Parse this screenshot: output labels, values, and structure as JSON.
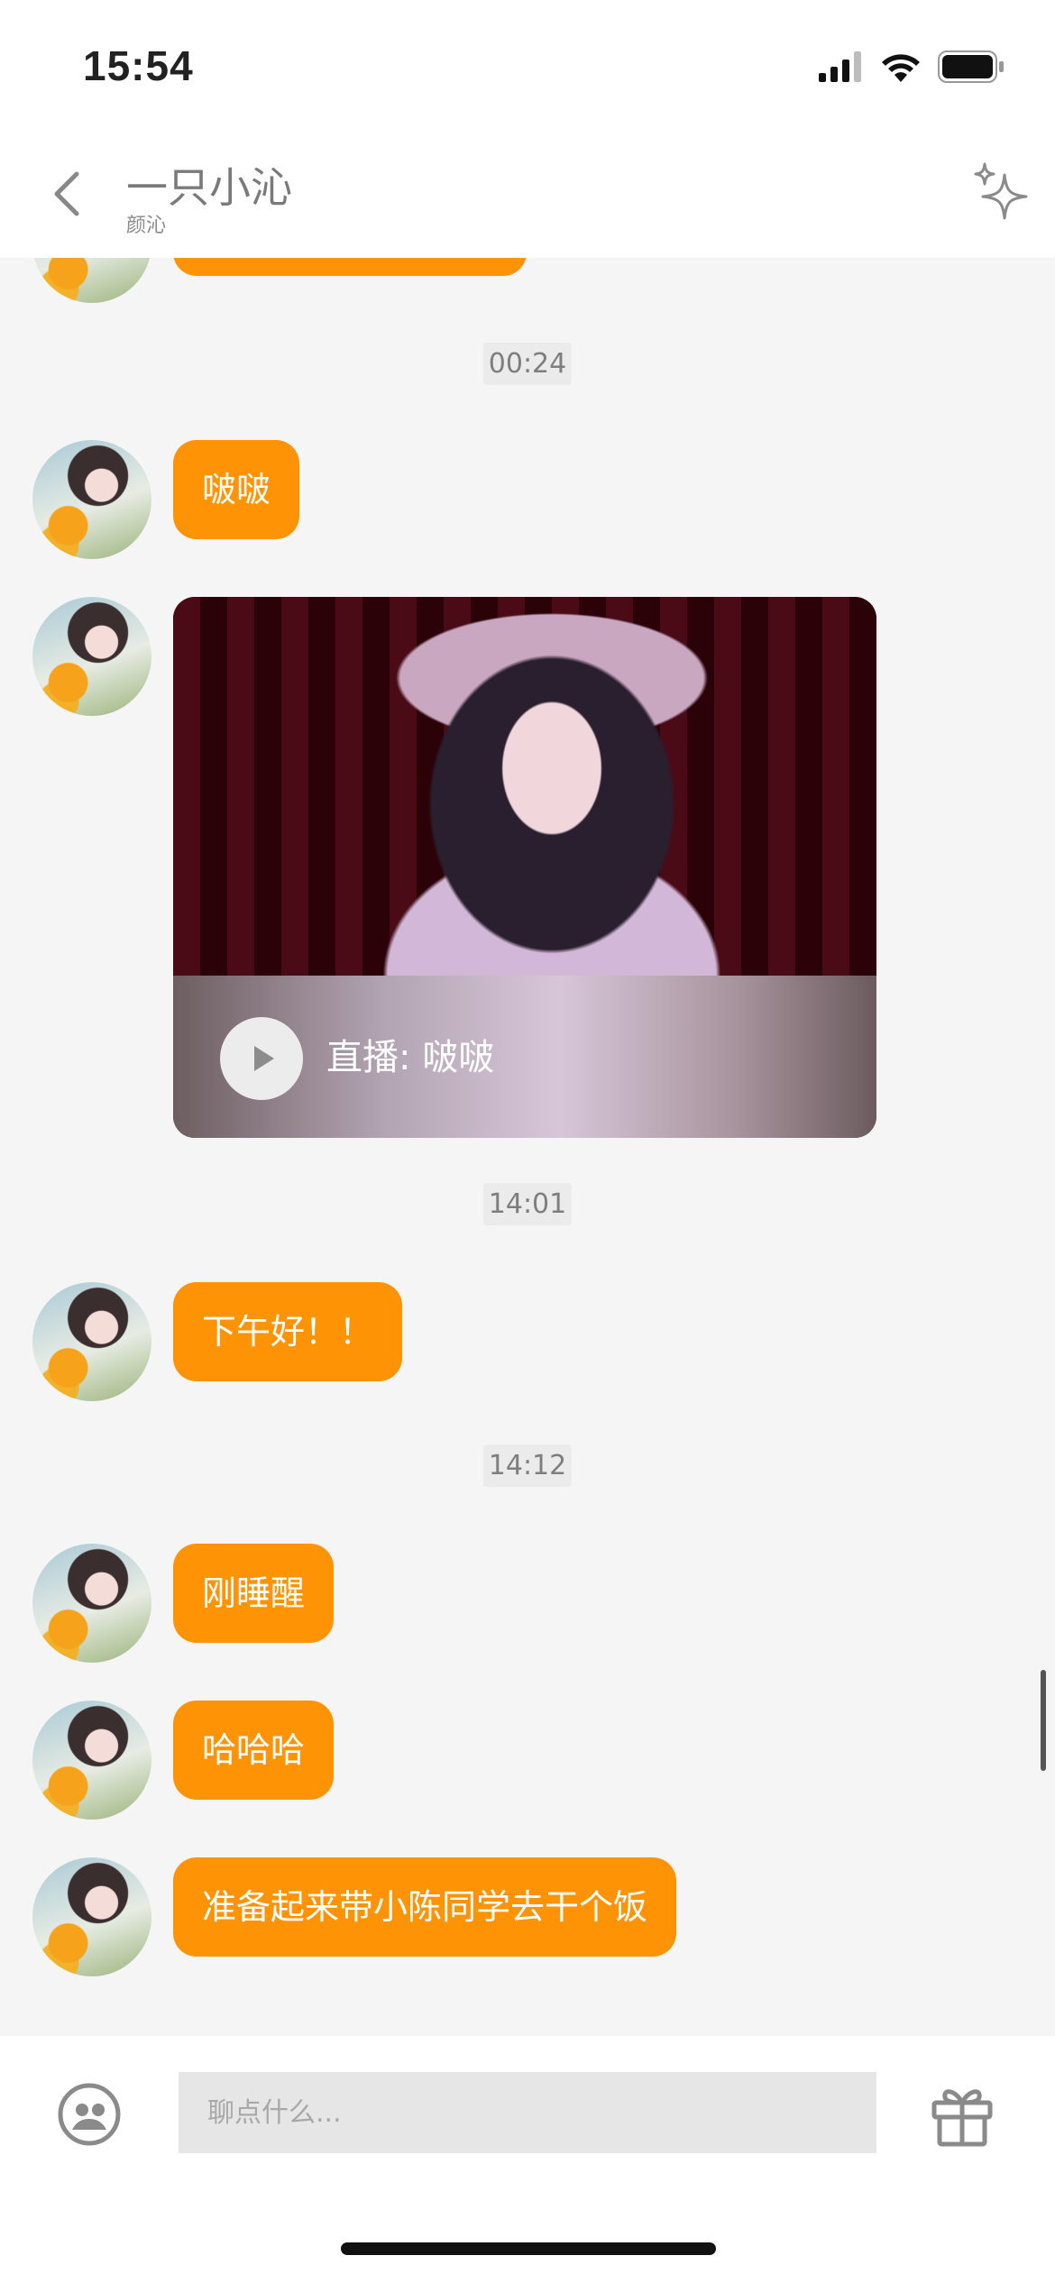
{
  "status_bar": {
    "time": "15:54"
  },
  "header": {
    "title": "一只小沁",
    "subtitle": "颜沁"
  },
  "messages": [
    {
      "type": "timestamp",
      "text": "00:24"
    },
    {
      "type": "text",
      "text": "啵啵"
    },
    {
      "type": "live",
      "label": "直播: 啵啵"
    },
    {
      "type": "timestamp",
      "text": "14:01"
    },
    {
      "type": "text",
      "text": "下午好！！"
    },
    {
      "type": "timestamp",
      "text": "14:12"
    },
    {
      "type": "text",
      "text": "刚睡醒"
    },
    {
      "type": "text",
      "text": "哈哈哈"
    },
    {
      "type": "text",
      "text": "准备起来带小陈同学去干个饭"
    }
  ],
  "input": {
    "placeholder": "聊点什么..."
  },
  "colors": {
    "bubble": "#ff9306",
    "background": "#f5f5f5"
  },
  "icons": [
    "back-chevron-icon",
    "sparkle-icon",
    "emoji-icon",
    "gift-icon",
    "play-icon",
    "signal-icon",
    "wifi-icon",
    "battery-icon"
  ]
}
